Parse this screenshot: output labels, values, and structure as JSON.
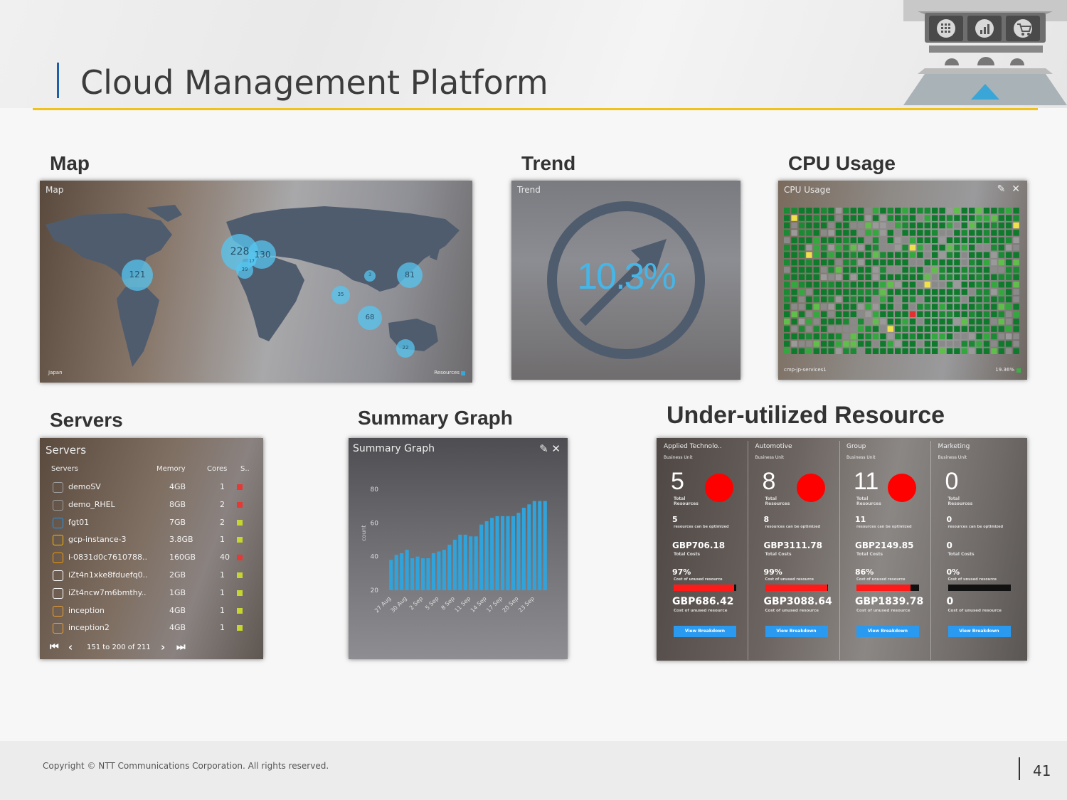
{
  "slide": {
    "title": "Cloud Management Platform",
    "copyright": "Copyright © NTT Communications Corporation. All rights reserved.",
    "page_number": "41"
  },
  "sections": {
    "map": "Map",
    "trend": "Trend",
    "cpu": "CPU Usage",
    "servers": "Servers",
    "summary": "Summary Graph",
    "underutilized": "Under-utilized Resource"
  },
  "map_panel": {
    "title": "Map",
    "footer_left": "Japan",
    "footer_right": "Resources",
    "clusters": [
      {
        "label": "121"
      },
      {
        "label": "228"
      },
      {
        "label": "130"
      },
      {
        "label": "39"
      },
      {
        "label": "17"
      },
      {
        "label": "3"
      },
      {
        "label": "81"
      },
      {
        "label": "35"
      },
      {
        "label": "68"
      },
      {
        "label": "22"
      }
    ]
  },
  "trend_panel": {
    "title": "Trend",
    "value": "10.3%"
  },
  "cpu_panel": {
    "title": "CPU Usage",
    "footer_left": "cmp-jp-services1",
    "footer_right": "19.36%"
  },
  "servers_panel": {
    "title": "Servers",
    "headers": [
      "Servers",
      "Memory",
      "Cores",
      "S.."
    ],
    "rows": [
      {
        "name": "demoSV",
        "memory": "4GB",
        "cores": "1",
        "status": "#e53935",
        "icon": "#9e9e9e"
      },
      {
        "name": "demo_RHEL",
        "memory": "8GB",
        "cores": "2",
        "status": "#e53935",
        "icon": "#9e9e9e"
      },
      {
        "name": "fgt01",
        "memory": "7GB",
        "cores": "2",
        "status": "#c6d62e",
        "icon": "#2196f3"
      },
      {
        "name": "gcp-instance-3",
        "memory": "3.8GB",
        "cores": "1",
        "status": "#c6d62e",
        "icon": "#fbbc05"
      },
      {
        "name": "i-0831d0c7610788..",
        "memory": "160GB",
        "cores": "40",
        "status": "#e53935",
        "icon": "#f59b00"
      },
      {
        "name": "iZt4n1xke8fduefq0..",
        "memory": "2GB",
        "cores": "1",
        "status": "#c6d62e",
        "icon": "#ffffff"
      },
      {
        "name": "iZt4ncw7m6bmthy..",
        "memory": "1GB",
        "cores": "1",
        "status": "#c6d62e",
        "icon": "#ffffff"
      },
      {
        "name": "inception",
        "memory": "4GB",
        "cores": "1",
        "status": "#c6d62e",
        "icon": "#f0a030"
      },
      {
        "name": "inception2",
        "memory": "4GB",
        "cores": "1",
        "status": "#c6d62e",
        "icon": "#f0a030"
      }
    ],
    "pagination": "151 to 200 of 211"
  },
  "summary_panel": {
    "title": "Summary Graph"
  },
  "chart_data": {
    "type": "bar",
    "ylabel": "count",
    "ylim": [
      20,
      80
    ],
    "yticks": [
      20,
      40,
      60,
      80
    ],
    "xticks": [
      "27 Aug",
      "30 Aug",
      "2 Sep",
      "5 Sep",
      "8 Sep",
      "11 Sep",
      "14 Sep",
      "17 Sep",
      "20 Sep",
      "23 Sep"
    ],
    "values": [
      38,
      41,
      42,
      44,
      39,
      40,
      39,
      39,
      42,
      43,
      44,
      47,
      50,
      53,
      53,
      52,
      52,
      59,
      61,
      63,
      64,
      64,
      64,
      64,
      66,
      69,
      71,
      73,
      73,
      73
    ]
  },
  "underutilized_panel": {
    "columns": [
      {
        "unit": "Applied Technolo..",
        "unit_label": "Business Unit",
        "total": "5",
        "total_label": "Total\nResources",
        "optimizable": "5",
        "optimizable_label": "resources can be optimized",
        "costs": "GBP706.18",
        "costs_label": "Total Costs",
        "pct": "97%",
        "pct_label": "Cost of unused resource",
        "pct_value": 97,
        "unused_cost": "GBP686.42",
        "unused_label": "Cost of unused resource",
        "button": "View Breakdown",
        "has_dot": true
      },
      {
        "unit": "Automotive",
        "unit_label": "Business Unit",
        "total": "8",
        "total_label": "Total\nResources",
        "optimizable": "8",
        "optimizable_label": "resources can be optimized",
        "costs": "GBP3111.78",
        "costs_label": "Total Costs",
        "pct": "99%",
        "pct_label": "Cost of unused resource",
        "pct_value": 99,
        "unused_cost": "GBP3088.64",
        "unused_label": "Cost of unused resource",
        "button": "View Breakdown",
        "has_dot": true
      },
      {
        "unit": "Group",
        "unit_label": "Business Unit",
        "total": "11",
        "total_label": "Total\nResources",
        "optimizable": "11",
        "optimizable_label": "resources can be optimized",
        "costs": "GBP2149.85",
        "costs_label": "Total Costs",
        "pct": "86%",
        "pct_label": "Cost of unused resource",
        "pct_value": 86,
        "unused_cost": "GBP1839.78",
        "unused_label": "Cost of unused resource",
        "button": "View Breakdown",
        "has_dot": true
      },
      {
        "unit": "Marketing",
        "unit_label": "Business Unit",
        "total": "0",
        "total_label": "Total\nResources",
        "optimizable": "0",
        "optimizable_label": "resources can be optimized",
        "costs": "0",
        "costs_label": "Total Costs",
        "pct": "0%",
        "pct_label": "Cost of unused resource",
        "pct_value": 0,
        "unused_cost": "0",
        "unused_label": "Cost of unused resource",
        "button": "View Breakdown",
        "has_dot": false
      }
    ]
  },
  "colors": {
    "accent_gold": "#f0c21c",
    "title_bar": "#1f5fa8",
    "alert_red": "#ff0000",
    "button_blue": "#2a9af0"
  },
  "icons": {
    "logo_tools": [
      "grid-icon",
      "analytics-icon",
      "cart-icon"
    ]
  }
}
